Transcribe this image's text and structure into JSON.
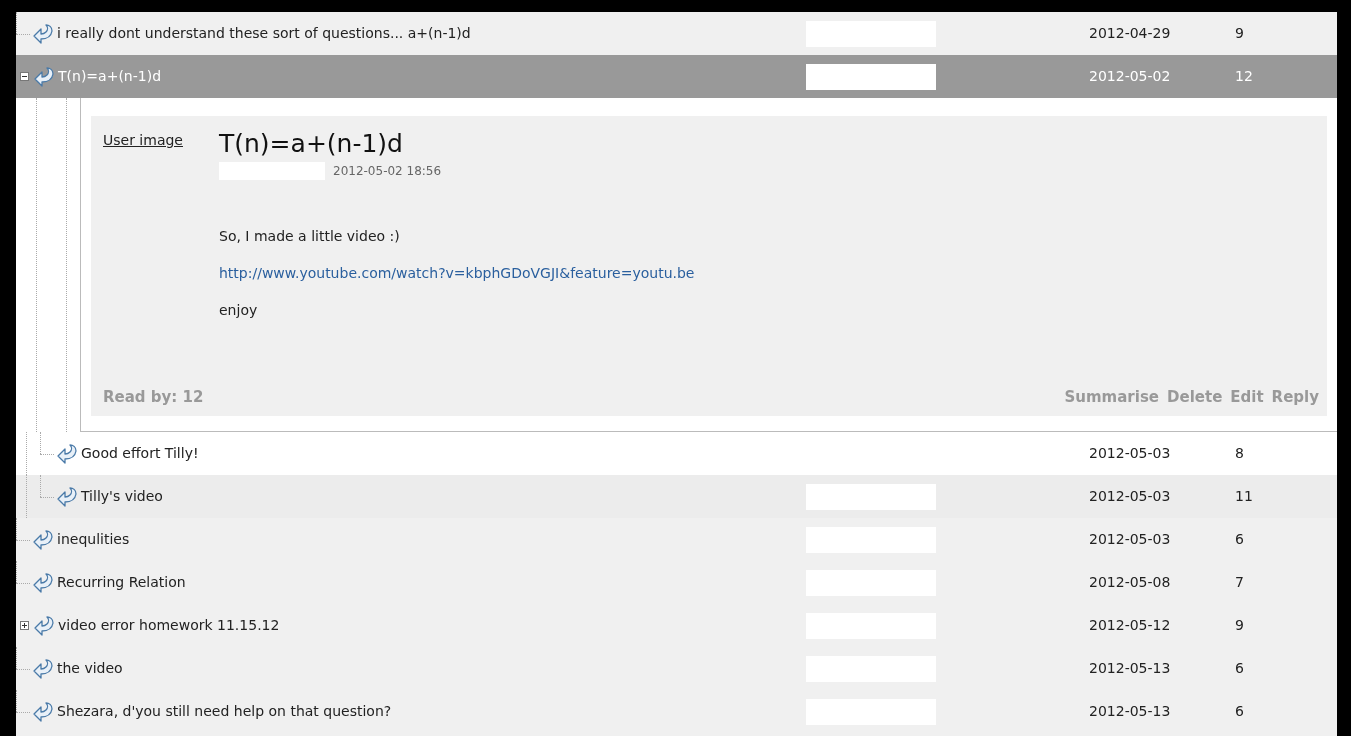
{
  "threads": [
    {
      "title": "i really dont understand these sort of questions... a+(n-1)d",
      "date": "2012-04-29",
      "reads": "9",
      "selected": false
    },
    {
      "title": "T(n)=a+(n-1)d",
      "date": "2012-05-02",
      "reads": "12",
      "selected": true,
      "expanded": true,
      "post": {
        "user_image": "User image",
        "title": "T(n)=a+(n-1)d",
        "posted": "2012-05-02 18:56",
        "body": [
          {
            "kind": "text",
            "text": "So, I made a little video :)"
          },
          {
            "kind": "link",
            "text": "http://www.youtube.com/watch?v=kbphGDoVGJI&feature=youtu.be"
          },
          {
            "kind": "text",
            "text": "enjoy"
          }
        ],
        "read_by": "Read by: 12",
        "actions": [
          "Summarise",
          "Delete",
          "Edit",
          "Reply"
        ]
      },
      "children": [
        {
          "title": "Good effort Tilly!",
          "date": "2012-05-03",
          "reads": "8",
          "selected": false
        },
        {
          "title": "Tilly's video",
          "date": "2012-05-03",
          "reads": "11",
          "selected": false
        }
      ]
    },
    {
      "title": "inequlities",
      "date": "2012-05-03",
      "reads": "6",
      "selected": false
    },
    {
      "title": "Recurring Relation",
      "date": "2012-05-08",
      "reads": "7",
      "selected": false
    },
    {
      "title": "video error homework 11.15.12",
      "date": "2012-05-12",
      "reads": "9",
      "selected": false,
      "expanded": false
    },
    {
      "title": "the video",
      "date": "2012-05-13",
      "reads": "6",
      "selected": false
    },
    {
      "title": "Shezara, d'you still need help on that question?",
      "date": "2012-05-13",
      "reads": "6",
      "selected": false
    }
  ]
}
